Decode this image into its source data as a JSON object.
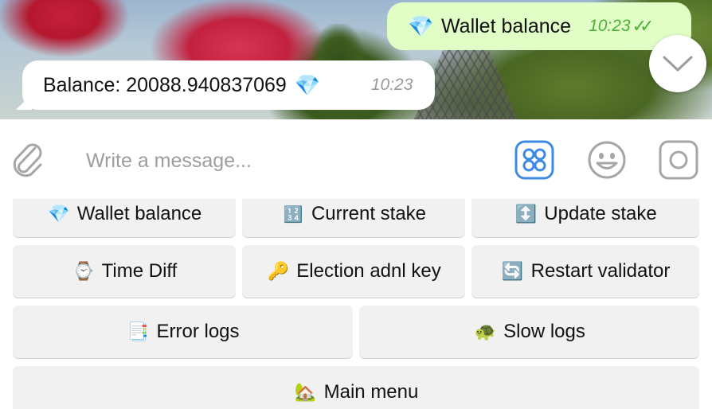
{
  "messages": {
    "outgoing": {
      "text": "Wallet balance",
      "time": "10:23",
      "icon": "gem-icon",
      "ticks": "✓✓"
    },
    "incoming": {
      "text": "Balance: 20088.940837069",
      "time": "10:23",
      "icon": "gem-icon"
    }
  },
  "input": {
    "placeholder": "Write a message..."
  },
  "keyboard": {
    "rows": [
      [
        {
          "label": "Wallet balance",
          "icon": "gem-icon"
        },
        {
          "label": "Current stake",
          "icon": "numbers-icon"
        },
        {
          "label": "Update stake",
          "icon": "up-down-arrow-icon"
        }
      ],
      [
        {
          "label": "Time Diff",
          "icon": "watch-icon"
        },
        {
          "label": "Election adnl key",
          "icon": "key-icon"
        },
        {
          "label": "Restart validator",
          "icon": "refresh-icon"
        }
      ],
      [
        {
          "label": "Error logs",
          "icon": "document-icon"
        },
        {
          "label": "Slow logs",
          "icon": "turtle-icon"
        }
      ],
      [
        {
          "label": "Main menu",
          "icon": "house-icon"
        }
      ]
    ]
  },
  "colors": {
    "outgoing_bubble": "#e1fec6",
    "accent_blue": "#3d8be3",
    "time_green": "#4caf3a",
    "key_bg": "#f1f1f2"
  }
}
